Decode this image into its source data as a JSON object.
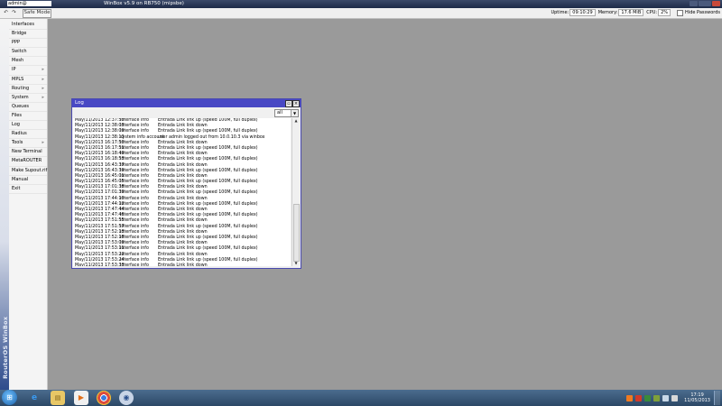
{
  "titlebar": {
    "user": "admin@",
    "title": "WinBox v5.9 on RB750 (mipsbe)"
  },
  "toolbar": {
    "undo_icon": "undo-icon",
    "redo_icon": "redo-icon",
    "safe_mode": "Safe Mode",
    "uptime_label": "Uptime:",
    "uptime_value": "09:10:29",
    "memory_label": "Memory:",
    "memory_value": "17.6 MiB",
    "cpu_label": "CPU:",
    "cpu_value": "2%",
    "hide_passwords": "Hide Passwords"
  },
  "sidebar": {
    "brand": "RouterOS WinBox",
    "items": [
      {
        "label": "Interfaces",
        "arrow": ""
      },
      {
        "label": "Bridge",
        "arrow": ""
      },
      {
        "label": "PPP",
        "arrow": ""
      },
      {
        "label": "Switch",
        "arrow": ""
      },
      {
        "label": "Mesh",
        "arrow": ""
      },
      {
        "label": "IP",
        "arrow": "▸"
      },
      {
        "label": "MPLS",
        "arrow": "▸"
      },
      {
        "label": "Routing",
        "arrow": "▸"
      },
      {
        "label": "System",
        "arrow": "▸"
      },
      {
        "label": "Queues",
        "arrow": ""
      },
      {
        "label": "Files",
        "arrow": ""
      },
      {
        "label": "Log",
        "arrow": ""
      },
      {
        "label": "Radius",
        "arrow": ""
      },
      {
        "label": "Tools",
        "arrow": "▸"
      },
      {
        "label": "New Terminal",
        "arrow": ""
      },
      {
        "label": "MetaROUTER",
        "arrow": ""
      },
      {
        "label": "Make Supout.rif",
        "arrow": ""
      },
      {
        "label": "Manual",
        "arrow": ""
      },
      {
        "label": "Exit",
        "arrow": ""
      }
    ]
  },
  "log_window": {
    "title": "Log",
    "filter_value": "all",
    "entries": [
      {
        "time": "May/11/2013 12:37:50",
        "topics": "interface info",
        "message": "Entrada Link link up (speed 100M, full duplex)"
      },
      {
        "time": "May/11/2013 12:38:03",
        "topics": "interface info",
        "message": "Entrada Link link down"
      },
      {
        "time": "May/11/2013 12:38:09",
        "topics": "interface info",
        "message": "Entrada Link link up (speed 100M, full duplex)"
      },
      {
        "time": "May/11/2013 12:38:13",
        "topics": "system info account",
        "message": "user admin logged out from 10.0.10.3 via winbox"
      },
      {
        "time": "May/11/2013 16:17:50",
        "topics": "interface info",
        "message": "Entrada Link link down"
      },
      {
        "time": "May/11/2013 16:17:51",
        "topics": "interface info",
        "message": "Entrada Link link up (speed 100M, full duplex)"
      },
      {
        "time": "May/11/2013 16:18:49",
        "topics": "interface info",
        "message": "Entrada Link link down"
      },
      {
        "time": "May/11/2013 16:18:53",
        "topics": "interface info",
        "message": "Entrada Link link up (speed 100M, full duplex)"
      },
      {
        "time": "May/11/2013 16:43:37",
        "topics": "interface info",
        "message": "Entrada Link link down"
      },
      {
        "time": "May/11/2013 16:43:39",
        "topics": "interface info",
        "message": "Entrada Link link up (speed 100M, full duplex)"
      },
      {
        "time": "May/11/2013 16:45:01",
        "topics": "interface info",
        "message": "Entrada Link link down"
      },
      {
        "time": "May/11/2013 16:45:05",
        "topics": "interface info",
        "message": "Entrada Link link up (speed 100M, full duplex)"
      },
      {
        "time": "May/11/2013 17:01:38",
        "topics": "interface info",
        "message": "Entrada Link link down"
      },
      {
        "time": "May/11/2013 17:01:39",
        "topics": "interface info",
        "message": "Entrada Link link up (speed 100M, full duplex)"
      },
      {
        "time": "May/11/2013 17:44:10",
        "topics": "interface info",
        "message": "Entrada Link link down"
      },
      {
        "time": "May/11/2013 17:44:12",
        "topics": "interface info",
        "message": "Entrada Link link up (speed 100M, full duplex)"
      },
      {
        "time": "May/11/2013 17:47:44",
        "topics": "interface info",
        "message": "Entrada Link link down"
      },
      {
        "time": "May/11/2013 17:47:46",
        "topics": "interface info",
        "message": "Entrada Link link up (speed 100M, full duplex)"
      },
      {
        "time": "May/11/2013 17:51:55",
        "topics": "interface info",
        "message": "Entrada Link link down"
      },
      {
        "time": "May/11/2013 17:51:57",
        "topics": "interface info",
        "message": "Entrada Link link up (speed 100M, full duplex)"
      },
      {
        "time": "May/11/2013 17:52:13",
        "topics": "interface info",
        "message": "Entrada Link link down"
      },
      {
        "time": "May/11/2013 17:52:18",
        "topics": "interface info",
        "message": "Entrada Link link up (speed 100M, full duplex)"
      },
      {
        "time": "May/11/2013 17:53:09",
        "topics": "interface info",
        "message": "Entrada Link link down"
      },
      {
        "time": "May/11/2013 17:53:11",
        "topics": "interface info",
        "message": "Entrada Link link up (speed 100M, full duplex)"
      },
      {
        "time": "May/11/2013 17:53:22",
        "topics": "interface info",
        "message": "Entrada Link link down"
      },
      {
        "time": "May/11/2013 17:53:24",
        "topics": "interface info",
        "message": "Entrada Link link up (speed 100M, full duplex)"
      },
      {
        "time": "May/11/2013 17:53:33",
        "topics": "interface info",
        "message": "Entrada Link link down"
      }
    ]
  },
  "taskbar": {
    "start_icon": "windows-start-icon",
    "clock_time": "17:19",
    "clock_date": "11/05/2013"
  },
  "colors": {
    "desktop": "#9a9a9a",
    "log_title": "#4848c4",
    "taskbar": "#2c4866"
  }
}
